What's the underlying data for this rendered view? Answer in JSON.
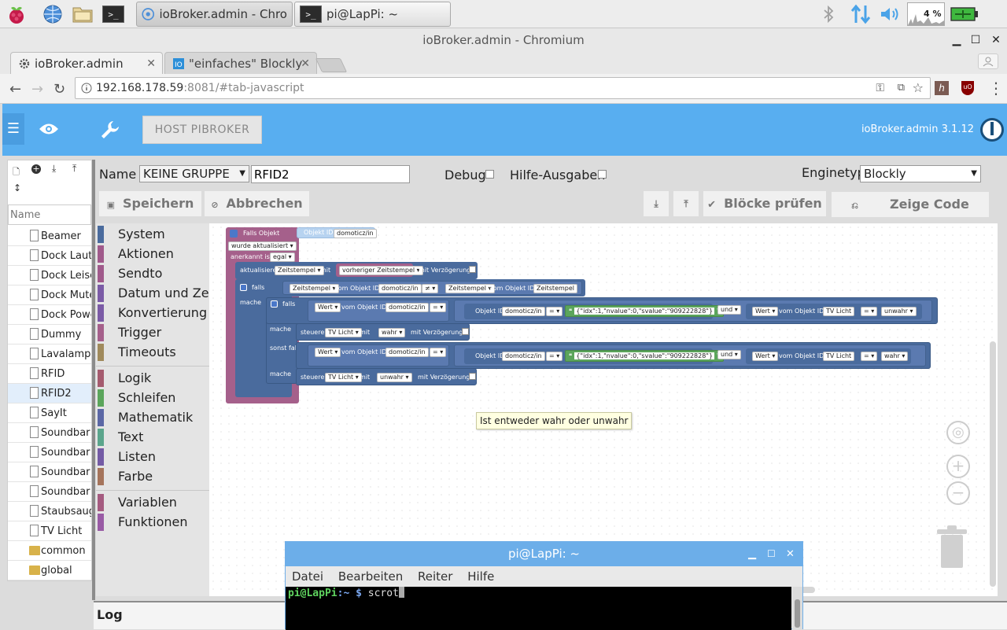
{
  "taskbar": {
    "tasks": [
      {
        "label": "ioBroker.admin - Chro"
      },
      {
        "label": "pi@LapPi: ~"
      }
    ],
    "cpu_text": "4 %",
    "term_glyph": ">_"
  },
  "browser": {
    "window_title": "ioBroker.admin - Chromium",
    "tabs": [
      {
        "label": "ioBroker.admin"
      },
      {
        "label": "\"einfaches\" Blockly"
      }
    ],
    "url_host": "192.168.178.59",
    "url_rest": ":8081/#tab-javascript"
  },
  "header": {
    "host_button": "HOST PIBROKER",
    "version": "ioBroker.admin 3.1.12"
  },
  "tree": {
    "search_placeholder": "Name",
    "items": [
      {
        "label": "Beamer",
        "type": "file"
      },
      {
        "label": "Dock Lautet",
        "type": "file"
      },
      {
        "label": "Dock Leiser",
        "type": "file"
      },
      {
        "label": "Dock Mute",
        "type": "file"
      },
      {
        "label": "Dock Power",
        "type": "file"
      },
      {
        "label": "Dummy",
        "type": "file"
      },
      {
        "label": "Lavalampe",
        "type": "file"
      },
      {
        "label": "RFID",
        "type": "file"
      },
      {
        "label": "RFID2",
        "type": "file",
        "selected": true
      },
      {
        "label": "SayIt",
        "type": "file"
      },
      {
        "label": "Soundbar L",
        "type": "file"
      },
      {
        "label": "Soundbar L",
        "type": "file"
      },
      {
        "label": "Soundbar P",
        "type": "file"
      },
      {
        "label": "Soundbar Q",
        "type": "file"
      },
      {
        "label": "Staubsauger",
        "type": "file"
      },
      {
        "label": "TV Licht",
        "type": "file"
      },
      {
        "label": "common",
        "type": "folder"
      },
      {
        "label": "global",
        "type": "folder"
      }
    ]
  },
  "form": {
    "name_label": "Name",
    "group_select": "KEINE GRUPPE",
    "script_name": "RFID2",
    "debug_label": "Debug",
    "help_label": "Hilfe-Ausgaben",
    "engine_label": "Enginetyp",
    "engine_value": "Blockly",
    "save": "Speichern",
    "cancel": "Abbrechen",
    "check_blocks": "Blöcke prüfen",
    "show_code": "Zeige Code"
  },
  "toolbox": {
    "group1": [
      {
        "label": "System",
        "color": "#4a6b9d"
      },
      {
        "label": "Aktionen",
        "color": "#a05a8b"
      },
      {
        "label": "Sendto",
        "color": "#a05a8b"
      },
      {
        "label": "Datum und Zeit",
        "color": "#7b5ba6"
      },
      {
        "label": "Konvertierung",
        "color": "#7b5ba6"
      },
      {
        "label": "Trigger",
        "color": "#a5608b"
      },
      {
        "label": "Timeouts",
        "color": "#a08a5c"
      }
    ],
    "group2": [
      {
        "label": "Logik",
        "color": "#a55b6e"
      },
      {
        "label": "Schleifen",
        "color": "#5ba55b"
      },
      {
        "label": "Mathematik",
        "color": "#5b67a5"
      },
      {
        "label": "Text",
        "color": "#5ba58c"
      },
      {
        "label": "Listen",
        "color": "#745ba5"
      },
      {
        "label": "Farbe",
        "color": "#a5745b"
      }
    ],
    "group3": [
      {
        "label": "Variablen",
        "color": "#a55b80"
      },
      {
        "label": "Funktionen",
        "color": "#995ba5"
      }
    ]
  },
  "blocks": {
    "trigger_title": "Falls Objekt",
    "trigger_oid_label": "Objekt ID",
    "trigger_oid": "domoticz/in",
    "trigger_cond": "wurde aktualisiert",
    "ack_label": "anerkannt ist",
    "ack_value": "egal",
    "update_label": "aktualisiere",
    "update_target": "Zeitstempel",
    "with": "mit",
    "prev_timestamp": "vorheriger Zeitstempel",
    "with_delay": "mit Verzögerung",
    "if": "falls",
    "do": "mache",
    "else_if": "sonst falls",
    "timestamp": "Zeitstempel",
    "of_object_id": "vom Objekt ID",
    "oid": "domoticz/in",
    "neq": "≠",
    "eq": "=",
    "value": "Wert",
    "object_id": "Objekt ID",
    "json_literal": "{\"idx\":1,\"nvalue\":0,\"svalue\":\"909222828\"}",
    "and": "und",
    "tv_licht": "TV Licht",
    "false_val": "unwahr",
    "true_val": "wahr",
    "control": "steuere"
  },
  "tooltip": "Ist entweder wahr oder unwahr",
  "terminal": {
    "title": "pi@LapPi: ~",
    "menu": [
      "Datei",
      "Bearbeiten",
      "Reiter",
      "Hilfe"
    ],
    "prompt_user": "pi@LapPi",
    "prompt_path": ":~ $",
    "command": "scrot"
  },
  "log_label": "Log",
  "colors": {
    "header_blue": "#58aef0",
    "block_trigger": "#a5608b",
    "block_system": "#4a6b9d",
    "block_text": "#5ba55b"
  }
}
